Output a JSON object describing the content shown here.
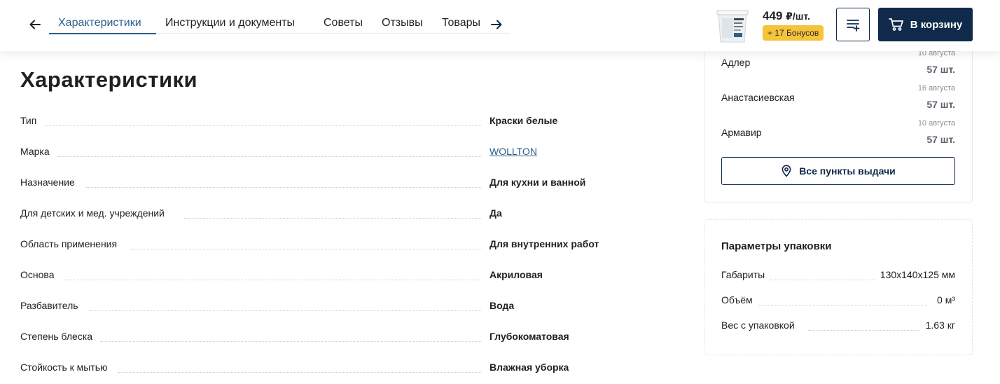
{
  "header": {
    "tabs": [
      {
        "label": "Характеристики",
        "active": true
      },
      {
        "label": "Инструкции и документы",
        "active": false
      },
      {
        "label": "Советы",
        "active": false
      },
      {
        "label": "Отзывы",
        "active": false
      },
      {
        "label": "Товары",
        "active": false
      }
    ],
    "price": "449",
    "price_unit": "₽/шт.",
    "bonus": "+ 17 Бонусов",
    "cart_label": "В корзину",
    "colors": {
      "primary": "#0f2a4a",
      "active_tab": "#2b5f8a",
      "bonus_bg": "#f5c43a"
    }
  },
  "specs": {
    "title": "Характеристики",
    "rows": [
      {
        "label": "Тип",
        "value": "Краски белые",
        "link": false
      },
      {
        "label": "Марка",
        "value": "WOLLTON",
        "link": true
      },
      {
        "label": "Назначение",
        "value": "Для кухни и ванной",
        "link": false
      },
      {
        "label": "Для детских и мед. учреждений",
        "value": "Да",
        "link": false
      },
      {
        "label": "Область применения",
        "value": "Для внутренних работ",
        "link": false
      },
      {
        "label": "Основа",
        "value": "Акриловая",
        "link": false
      },
      {
        "label": "Разбавитель",
        "value": "Вода",
        "link": false
      },
      {
        "label": "Степень блеска",
        "value": "Глубокоматовая",
        "link": false
      },
      {
        "label": "Стойкость к мытью",
        "value": "Влажная уборка",
        "link": false
      }
    ]
  },
  "pickup": {
    "cities": [
      {
        "name": "Адлер",
        "date": "10 августа",
        "qty": "57 шт."
      },
      {
        "name": "Анастасиевская",
        "date": "16 августа",
        "qty": "57 шт."
      },
      {
        "name": "Армавир",
        "date": "10 августа",
        "qty": "57 шт."
      }
    ],
    "all_points_label": "Все пункты выдачи"
  },
  "package": {
    "title": "Параметры упаковки",
    "rows": [
      {
        "label": "Габариты",
        "value": "130x140x125 мм"
      },
      {
        "label": "Объём",
        "value": "0 м³"
      },
      {
        "label": "Вес с упаковкой",
        "value": "1.63 кг"
      }
    ]
  }
}
